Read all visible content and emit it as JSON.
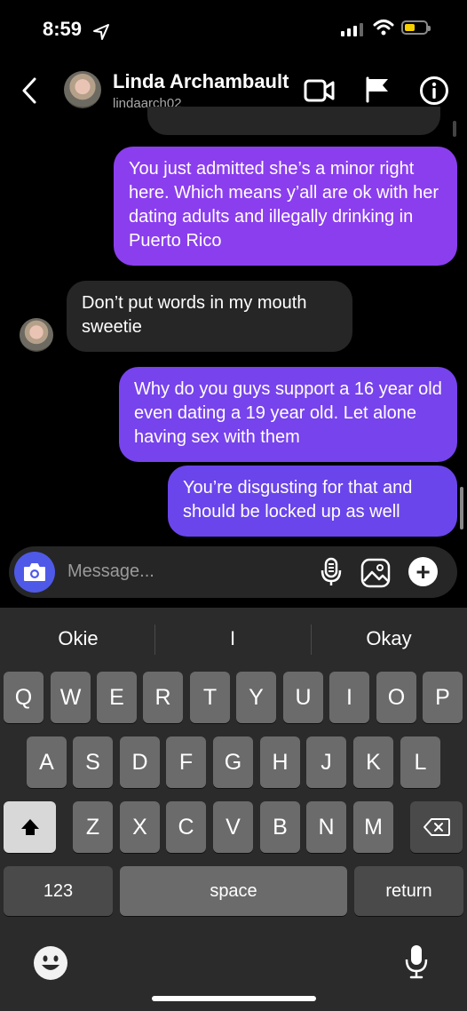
{
  "status_bar": {
    "time": "8:59"
  },
  "header": {
    "name": "Linda Archambault",
    "handle": "lindaarch02"
  },
  "messages": [
    {
      "from": "me",
      "text": "You just admitted she’s a minor right here. Which means y’all are ok with her dating adults and illegally drinking in Puerto Rico"
    },
    {
      "from": "them",
      "text": "Don’t put words in my mouth sweetie"
    },
    {
      "from": "me",
      "text": "Why do you guys support a 16 year old even dating a 19 year old. Let alone having sex with them"
    },
    {
      "from": "me",
      "text": "You’re disgusting for that and should be locked up as well"
    }
  ],
  "composer": {
    "placeholder": "Message..."
  },
  "keyboard": {
    "suggestions": [
      "Okie",
      "I",
      "Okay"
    ],
    "row1": [
      "Q",
      "W",
      "E",
      "R",
      "T",
      "Y",
      "U",
      "I",
      "O",
      "P"
    ],
    "row2": [
      "A",
      "S",
      "D",
      "F",
      "G",
      "H",
      "J",
      "K",
      "L"
    ],
    "row3": [
      "Z",
      "X",
      "C",
      "V",
      "B",
      "N",
      "M"
    ],
    "numbers_label": "123",
    "space_label": "space",
    "return_label": "return"
  },
  "icons": {
    "location": "location-arrow-icon",
    "back": "chevron-left-icon",
    "video": "video-camera-icon",
    "flag": "flag-icon",
    "info": "info-icon",
    "camera": "camera-icon",
    "mic": "microphone-icon",
    "gallery": "image-icon",
    "plus": "plus-icon",
    "shift": "shift-icon",
    "delete": "delete-icon",
    "emoji": "emoji-icon",
    "dictate": "dictation-microphone-icon"
  },
  "colors": {
    "sent_bubble_top": "#8b3eee",
    "sent_bubble_bottom": "#6a45eb",
    "received_bubble": "#262626",
    "camera_button": "#4f59e8",
    "battery_low": "#f5d000"
  }
}
